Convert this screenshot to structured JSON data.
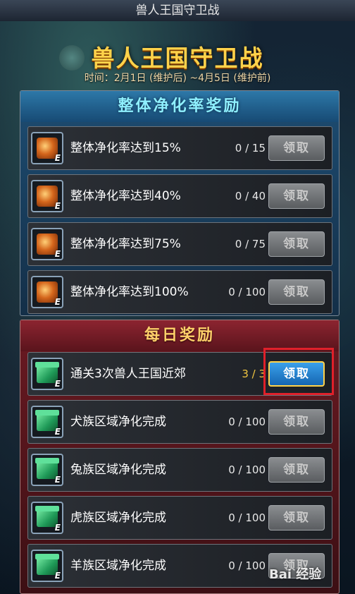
{
  "window": {
    "title": "兽人王国守卫战"
  },
  "banner": {
    "title": "兽人王国守卫战",
    "subtitle": "时间：2月1日 (维护后) ~4月5日 (维护前)"
  },
  "purify_section": {
    "title": "整体净化率奖励",
    "rows": [
      {
        "label": "整体净化率达到15%",
        "progress": "0 / 15",
        "button": "领取",
        "icon": "chest-icon",
        "badge": "E"
      },
      {
        "label": "整体净化率达到40%",
        "progress": "0 / 40",
        "button": "领取",
        "icon": "chest-icon",
        "badge": "E"
      },
      {
        "label": "整体净化率达到75%",
        "progress": "0 / 75",
        "button": "领取",
        "icon": "chest-icon",
        "badge": "E"
      },
      {
        "label": "整体净化率达到100%",
        "progress": "0 / 100",
        "button": "领取",
        "icon": "chest-icon",
        "badge": "E"
      }
    ]
  },
  "daily_section": {
    "title": "每日奖励",
    "rows": [
      {
        "label": "通关3次兽人王国近郊",
        "progress": "3 / 3",
        "button": "领取",
        "icon": "gift-box-icon",
        "badge": "E"
      },
      {
        "label": "犬族区域净化完成",
        "progress": "0 / 100",
        "button": "领取",
        "icon": "gift-box-icon",
        "badge": "E"
      },
      {
        "label": "兔族区域净化完成",
        "progress": "0 / 100",
        "button": "领取",
        "icon": "gift-box-icon",
        "badge": "E"
      },
      {
        "label": "虎族区域净化完成",
        "progress": "0 / 100",
        "button": "领取",
        "icon": "gift-box-icon",
        "badge": "E"
      },
      {
        "label": "羊族区域净化完成",
        "progress": "0 / 100",
        "button": "领取",
        "icon": "gift-box-icon",
        "badge": "E"
      }
    ]
  },
  "watermark": "Bai 经验",
  "colors": {
    "title_gold": "#ffd24a",
    "section_blue": "#8ff0ff",
    "done_progress": "#f2c640",
    "active_button": "#1f7cd0",
    "highlight_box": "#e0202a"
  }
}
